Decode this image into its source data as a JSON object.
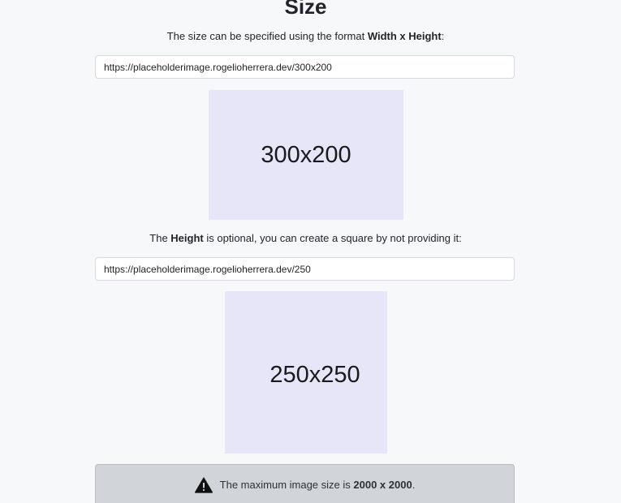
{
  "section": {
    "title": "Size"
  },
  "size_format": {
    "text_before": "The size can be specified using the format ",
    "emphasis": "Width x Height",
    "text_after": ":",
    "url_value": "https://placeholderimage.rogelioherrera.dev/300x200",
    "image_label": "300x200",
    "image_color": "#e6e6f8"
  },
  "square": {
    "text_before": "The ",
    "emphasis": "Height",
    "text_after": " is optional, you can create a square by not providing it:",
    "url_value": "https://placeholderimage.rogelioherrera.dev/250",
    "image_label": "250x250",
    "image_color": "#e6e6f8"
  },
  "alert": {
    "icon": "warning-triangle-icon",
    "text_before": "The maximum image size is ",
    "emphasis": "2000 x 2000",
    "text_after": ".",
    "background": "#d1d5da"
  }
}
